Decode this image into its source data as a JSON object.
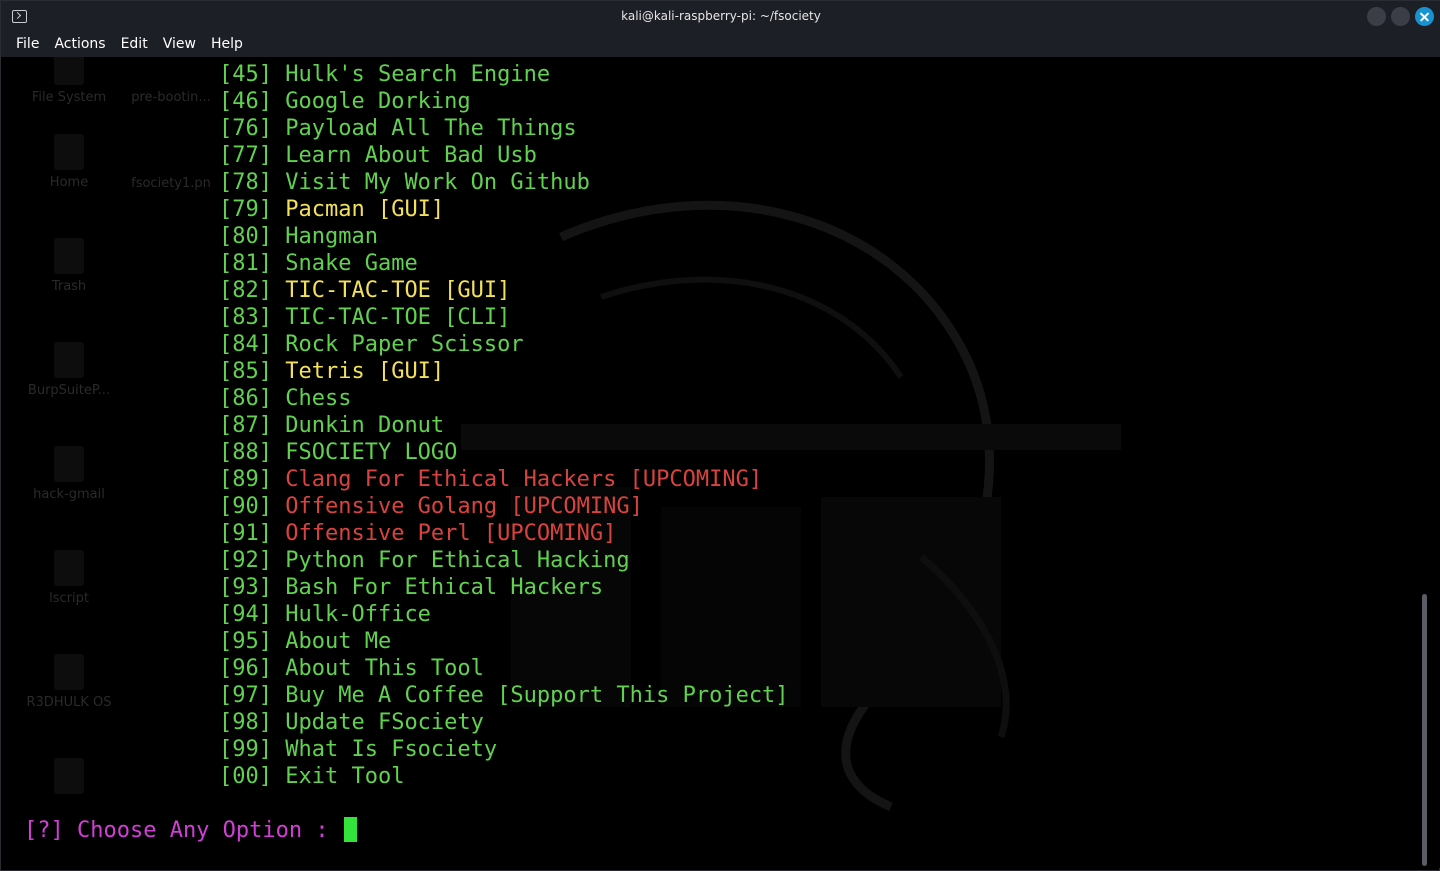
{
  "window": {
    "title": "kali@kali-raspberry-pi: ~/fsociety"
  },
  "menubar": {
    "items": [
      "File",
      "Actions",
      "Edit",
      "View",
      "Help"
    ]
  },
  "desktop": {
    "icons": [
      "File System",
      "pre-bootin...",
      "Home",
      "fsociety1.pn",
      "Trash",
      "BurpSuiteP...",
      "hack-gmail",
      "lscript",
      "R3DHULK OS",
      ""
    ]
  },
  "colors": {
    "green": "#61d24f",
    "yellow": "#f3e15a",
    "red": "#d9433f",
    "magenta": "#d33ed6",
    "cursor": "#33e33b"
  },
  "menu": [
    {
      "num": "[45]",
      "label": "Hulk's Search Engine",
      "color": "#61d24f"
    },
    {
      "num": "[46]",
      "label": "Google Dorking",
      "color": "#61d24f"
    },
    {
      "num": "[76]",
      "label": "Payload All The Things",
      "color": "#61d24f"
    },
    {
      "num": "[77]",
      "label": "Learn About Bad Usb",
      "color": "#61d24f"
    },
    {
      "num": "[78]",
      "label": "Visit My Work On Github",
      "color": "#61d24f"
    },
    {
      "num": "[79]",
      "label": "Pacman [GUI]",
      "color": "#f3e15a"
    },
    {
      "num": "[80]",
      "label": "Hangman",
      "color": "#61d24f"
    },
    {
      "num": "[81]",
      "label": "Snake Game",
      "color": "#61d24f"
    },
    {
      "num": "[82]",
      "label": "TIC-TAC-TOE [GUI]",
      "color": "#f3e15a"
    },
    {
      "num": "[83]",
      "label": "TIC-TAC-TOE [CLI]",
      "color": "#61d24f"
    },
    {
      "num": "[84]",
      "label": "Rock Paper Scissor",
      "color": "#61d24f"
    },
    {
      "num": "[85]",
      "label": "Tetris [GUI]",
      "color": "#f3e15a"
    },
    {
      "num": "[86]",
      "label": "Chess",
      "color": "#61d24f"
    },
    {
      "num": "[87]",
      "label": "Dunkin Donut",
      "color": "#61d24f"
    },
    {
      "num": "[88]",
      "label": "FSOCIETY LOGO",
      "color": "#61d24f"
    },
    {
      "num": "[89]",
      "label": "Clang For Ethical Hackers [UPCOMING]",
      "color": "#d9433f"
    },
    {
      "num": "[90]",
      "label": "Offensive Golang [UPCOMING]",
      "color": "#d9433f"
    },
    {
      "num": "[91]",
      "label": "Offensive Perl [UPCOMING]",
      "color": "#d9433f"
    },
    {
      "num": "[92]",
      "label": "Python For Ethical Hacking",
      "color": "#61d24f"
    },
    {
      "num": "[93]",
      "label": "Bash For Ethical Hackers",
      "color": "#61d24f"
    },
    {
      "num": "[94]",
      "label": "Hulk-Office",
      "color": "#61d24f"
    },
    {
      "num": "[95]",
      "label": "About Me",
      "color": "#61d24f"
    },
    {
      "num": "[96]",
      "label": "About This Tool",
      "color": "#61d24f"
    },
    {
      "num": "[97]",
      "label": "Buy Me A Coffee [Support This Project]",
      "color": "#61d24f"
    },
    {
      "num": "[98]",
      "label": "Update FSociety",
      "color": "#61d24f"
    },
    {
      "num": "[99]",
      "label": "What Is Fsociety",
      "color": "#61d24f"
    },
    {
      "num": "[00]",
      "label": "Exit Tool",
      "color": "#61d24f"
    }
  ],
  "prompt": {
    "text": "[?] Choose Any Option : "
  }
}
